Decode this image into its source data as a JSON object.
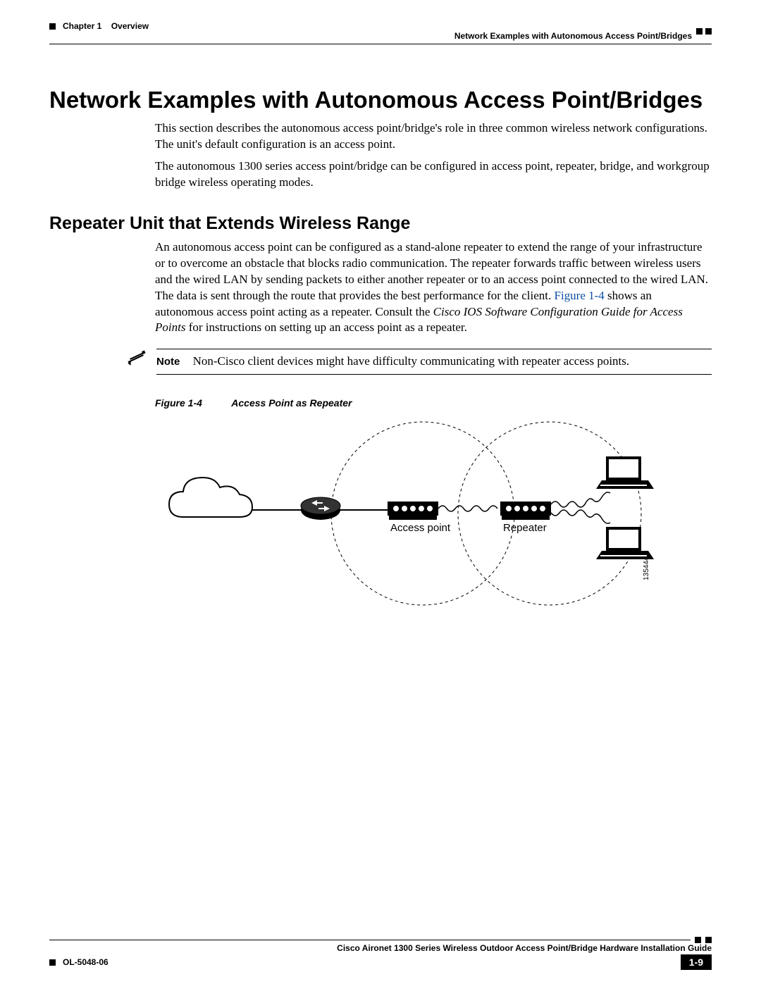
{
  "header": {
    "chapter_label": "Chapter 1",
    "chapter_title": "Overview",
    "section_title": "Network Examples with Autonomous Access Point/Bridges"
  },
  "h1": "Network Examples with Autonomous Access Point/Bridges",
  "intro": {
    "p1": "This section describes the autonomous access point/bridge's role in three common wireless network configurations. The unit's default configuration is an access point.",
    "p2": "The autonomous 1300 series access point/bridge can be configured in access point, repeater, bridge, and workgroup bridge wireless operating modes."
  },
  "h2": "Repeater Unit that Extends Wireless Range",
  "repeater": {
    "p1a": "An autonomous access point can be configured as a stand-alone repeater to extend the range of your infrastructure or to overcome an obstacle that blocks radio communication. The repeater forwards traffic between wireless users and the wired LAN by sending packets to either another repeater or to an access point connected to the wired LAN. The data is sent through the route that provides the best performance for the client. ",
    "figref": "Figure 1-4",
    "p1b": " shows an autonomous access point acting as a repeater. Consult the ",
    "doc_title": "Cisco IOS Software Configuration Guide for Access Points",
    "p1c": " for instructions on setting up an access point as a repeater."
  },
  "note": {
    "label": "Note",
    "text": "Non-Cisco client devices might have difficulty communicating with repeater access points."
  },
  "figure": {
    "num": "Figure 1-4",
    "title": "Access Point as Repeater",
    "label_ap": "Access point",
    "label_rpt": "Repeater",
    "img_id": "135444"
  },
  "footer": {
    "doc_title": "Cisco Aironet 1300 Series Wireless Outdoor Access Point/Bridge Hardware Installation Guide",
    "doc_num": "OL-5048-06",
    "page": "1-9"
  }
}
